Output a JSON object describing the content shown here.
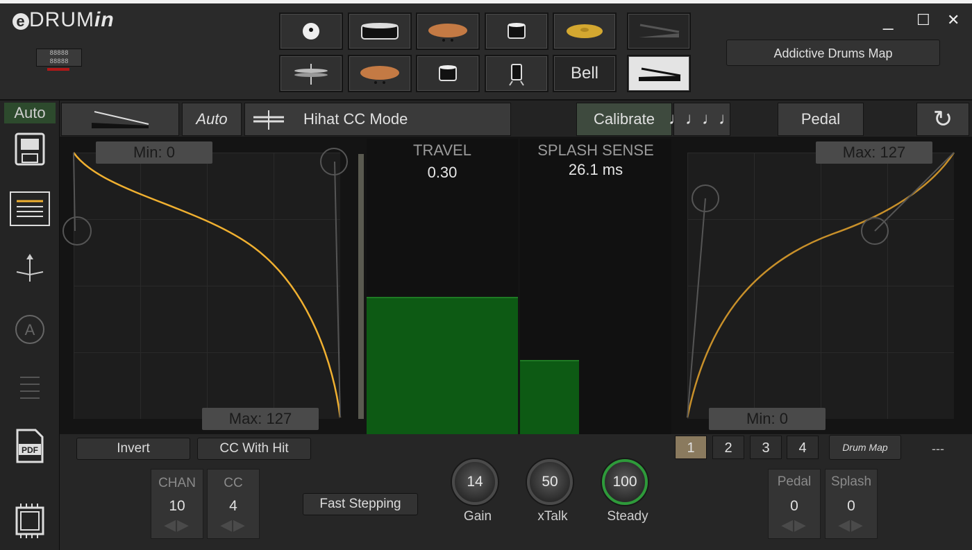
{
  "app": {
    "logo_prefix": "e",
    "logo_main": "DRUM",
    "logo_suffix": "in",
    "led_text": "88888\n88888",
    "map_button": "Addictive Drums Map"
  },
  "window": {
    "minimize": "_",
    "maximize": "☐",
    "close": "✕"
  },
  "pads": {
    "bell_label": "Bell"
  },
  "toolbar": {
    "auto_badge": "Auto",
    "auto_button": "Auto",
    "mode_label": "Hihat CC Mode",
    "calibrate": "Calibrate",
    "pedal": "Pedal",
    "refresh_icon": "↻",
    "notes_icon": "♩♩♩♩"
  },
  "left_curve": {
    "min_label": "Min: 0",
    "max_label": "Max: 127"
  },
  "right_curve": {
    "min_label": "Min: 0",
    "max_label": "Max: 127"
  },
  "travel": {
    "label": "TRAVEL",
    "value": "0.30",
    "level": 0.3
  },
  "splash": {
    "label": "SPLASH SENSE",
    "value": "26.1 ms",
    "level": 0.16
  },
  "bottom": {
    "invert": "Invert",
    "cc_with_hit": "CC With Hit",
    "fast_stepping": "Fast Stepping",
    "chan_label": "CHAN",
    "chan_value": "10",
    "cc_label": "CC",
    "cc_value": "4",
    "gain_value": "14",
    "gain_label": "Gain",
    "xtalk_value": "50",
    "xtalk_label": "xTalk",
    "steady_value": "100",
    "steady_label": "Steady",
    "slots": [
      "1",
      "2",
      "3",
      "4"
    ],
    "drum_map": "Drum Map",
    "dashes": "---",
    "pedal_label": "Pedal",
    "pedal_value": "0",
    "splash_label": "Splash",
    "splash_value": "0",
    "arrows": "◀▶"
  },
  "sidebar": {
    "pdf_label": "PDF"
  },
  "colors": {
    "accent": "#f0b030",
    "green_bar": "#0d5a14",
    "selected_slot": "#8a7a5e"
  }
}
